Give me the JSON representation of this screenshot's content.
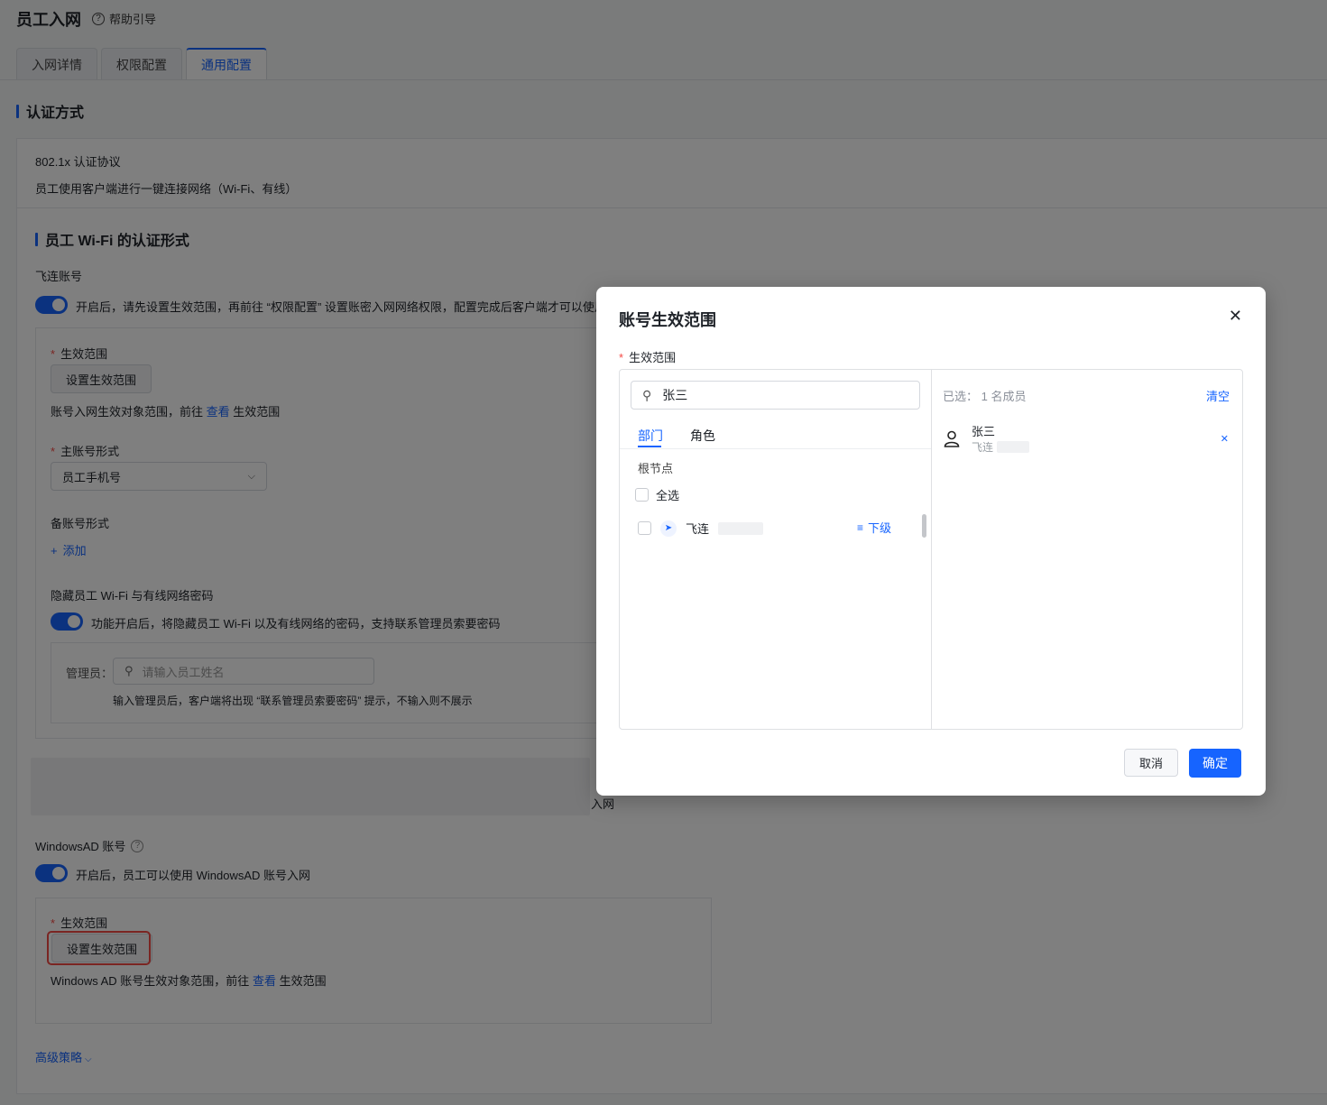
{
  "page": {
    "title": "员工入网",
    "help_label": "帮助引导",
    "tabs": [
      "入网详情",
      "权限配置",
      "通用配置"
    ],
    "active_tab": "通用配置"
  },
  "auth": {
    "section_title": "认证方式",
    "protocol_title": "802.1x 认证协议",
    "protocol_desc": "员工使用客户端进行一键连接网络（Wi-Fi、有线）",
    "wifi_section_title": "员工 Wi-Fi 的认证形式",
    "feilian": {
      "label": "飞连账号",
      "toggle_desc": "开启后，请先设置生效范围，再前往 “权限配置” 设置账密入网网络权限，配置完成后客户端才可以使用账密入",
      "scope_label": "生效范围",
      "scope_button": "设置生效范围",
      "scope_hint_prefix": "账号入网生效对象范围，前往",
      "scope_hint_link": "查看",
      "scope_hint_suffix": "生效范围",
      "main_account_label": "主账号形式",
      "main_account_value": "员工手机号",
      "backup_label": "备账号形式",
      "add_label": "添加",
      "hide_pwd_label": "隐藏员工 Wi-Fi 与有线网络密码",
      "hide_pwd_desc": "功能开启后，将隐藏员工 Wi-Fi 以及有线网络的密码，支持联系管理员索要密码",
      "admin_label": "管理员：",
      "admin_placeholder": "请输入员工姓名",
      "admin_hint": "输入管理员后，客户端将出现 “联系管理员索要密码” 提示，不输入则不展示",
      "tail_text": "入网"
    },
    "windows_ad": {
      "label": "WindowsAD 账号",
      "toggle_desc": "开启后，员工可以使用 WindowsAD 账号入网",
      "scope_label": "生效范围",
      "scope_button": "设置生效范围",
      "scope_hint_prefix": "Windows AD 账号生效对象范围，前往",
      "scope_hint_link": "查看",
      "scope_hint_suffix": "生效范围"
    },
    "advanced_label": "高级策略"
  },
  "modal": {
    "title": "账号生效范围",
    "field_label": "生效范围",
    "search_value": "张三",
    "tabs": [
      "部门",
      "角色"
    ],
    "active_tab": "部门",
    "root_label": "根节点",
    "select_all": "全选",
    "org_name": "飞连",
    "sub_level": "下级",
    "selected_prefix": "已选：",
    "selected_count": "1 名成员",
    "clear_label": "清空",
    "selected_member_name": "张三",
    "selected_member_org": "飞连",
    "cancel_label": "取消",
    "confirm_label": "确定"
  },
  "colors": {
    "primary": "#1664ff",
    "required": "#f54a45",
    "highlight_box": "#f54a45"
  }
}
